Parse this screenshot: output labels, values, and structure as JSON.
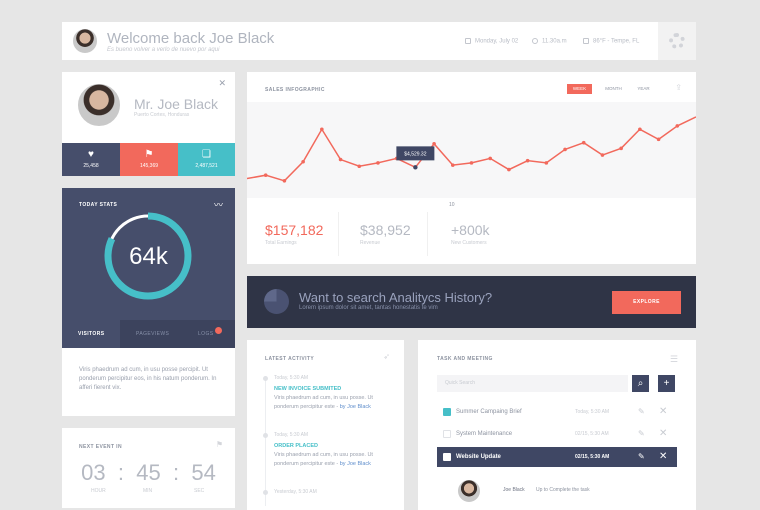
{
  "header": {
    "welcome": "Welcome back Joe Black",
    "subtitle": "Es bueno volver a verlo de nuevo por aqui",
    "date": "Monday, July 02",
    "time": "11.30a.m",
    "weather": "86°F - Tempe, FL"
  },
  "profile": {
    "name": "Mr. Joe Black",
    "location": "Puerto Cortes, Honduras",
    "stats": [
      {
        "icon": "heart-icon",
        "glyph": "♥",
        "value": "25,458",
        "color": "#464e6b"
      },
      {
        "icon": "flag-icon",
        "glyph": "⚑",
        "value": "145,369",
        "color": "#f2695c"
      },
      {
        "icon": "chat-icon",
        "glyph": "❏",
        "value": "2,487,521",
        "color": "#46bfc8"
      }
    ]
  },
  "today": {
    "title": "TODAY STATS",
    "value": "64k",
    "progress": 0.82,
    "tabs": [
      "VISITORS",
      "PAGEVIEWS",
      "LOGS"
    ],
    "description": "Viris phaedrum ad cum, in usu posse percipit. Ut ponderum percipitur eos, in his natum ponderum. In afferi fierent vix."
  },
  "event": {
    "title": "NEXT EVENT IN",
    "hours": "03",
    "minutes": "45",
    "seconds": "54",
    "labels": [
      "HOUR",
      "MIN",
      "SEC"
    ]
  },
  "sales": {
    "title": "SALES INFOGRAPHIC",
    "periods": [
      "WEEK",
      "MONTH",
      "YEAR"
    ],
    "active_period": "WEEK",
    "tooltip": "$4,529.32",
    "kpis": [
      {
        "value": "$157,182",
        "label": "Total Earnings",
        "color": "#f2695c"
      },
      {
        "value": "$38,952",
        "label": "Revenue",
        "color": "#b5b9c2"
      },
      {
        "value": "+800k",
        "label": "New Customers",
        "color": "#b5b9c2"
      }
    ]
  },
  "chart_data": {
    "type": "line",
    "xlabel": "10",
    "values": [
      52,
      55,
      50,
      67,
      96,
      69,
      63,
      66,
      70,
      62,
      83,
      64,
      66,
      70,
      60,
      68,
      66,
      78,
      84,
      73,
      79,
      96,
      87,
      99,
      107
    ]
  },
  "banner": {
    "heading": "Want to search Analitycs History?",
    "text": "Lorem ipsum dolor sit amet, tantas honestatis te vim",
    "button": "EXPLORE"
  },
  "activity": {
    "title": "LATEST ACTIVITY",
    "items": [
      {
        "time": "Today, 5:30 AM",
        "heading": "NEW INVOICE SUBMITED",
        "text": "Viris phaedrum ad cum, in usu posse. Ut ponderum percipitur este -",
        "by": "by Joe Black"
      },
      {
        "time": "Today, 5:30 AM",
        "heading": "ORDER PLACED",
        "text": "Viris phaedrum ad cum, in usu posse. Ut ponderum percipitur este -",
        "by": "by Joe Black"
      },
      {
        "time": "Yesterday, 5:30 AM"
      }
    ]
  },
  "tasks": {
    "title": "TASK AND MEETING",
    "search_placeholder": "Quick Search",
    "items": [
      {
        "label": "Summer Campaing Brief",
        "date": "Today, 5:30 AM",
        "checked": true
      },
      {
        "label": "System Maintenance",
        "date": "02/15, 5:30 AM",
        "checked": false
      },
      {
        "label": "Website Update",
        "date": "02/15, 5:30 AM",
        "checked": false,
        "active": true
      }
    ],
    "user_name": "Joe Black",
    "user_message": "Up to Complete the task"
  }
}
